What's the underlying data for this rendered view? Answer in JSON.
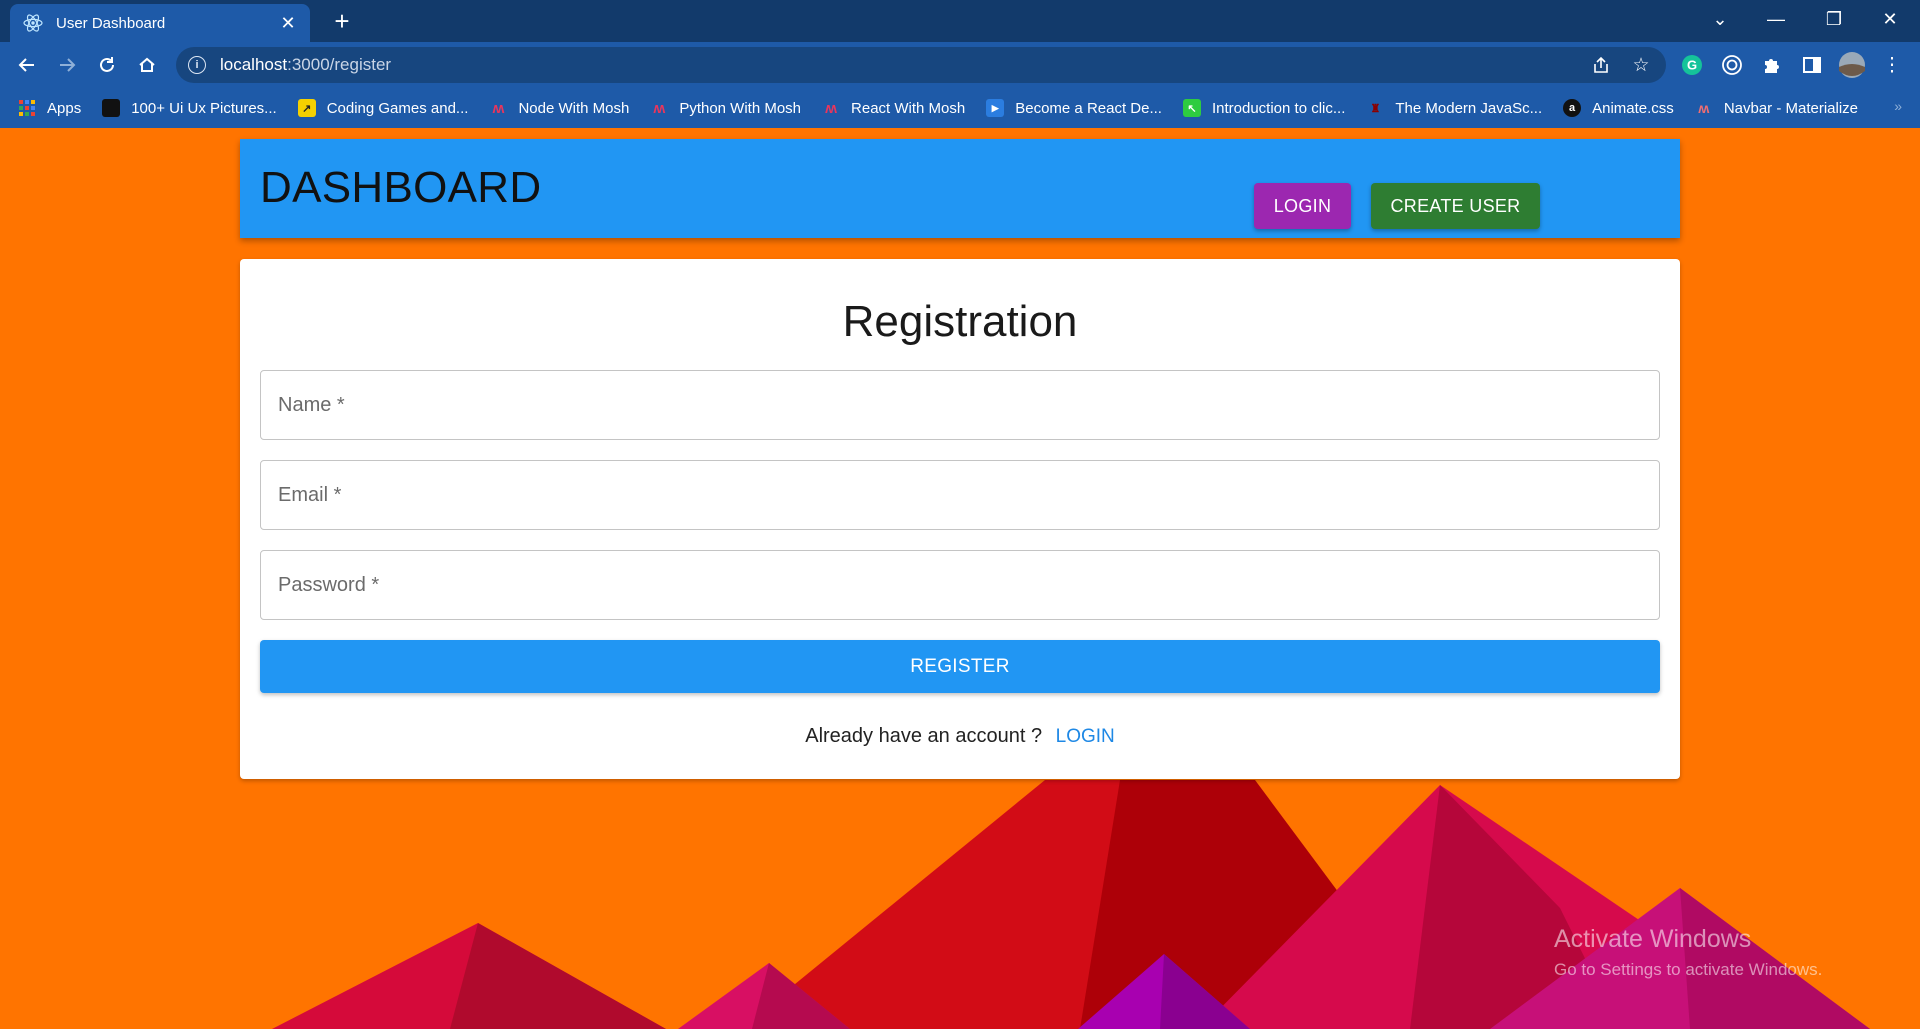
{
  "browser": {
    "tab_title": "User Dashboard",
    "tab_close": "✕",
    "new_tab": "+",
    "url_host": "localhost",
    "url_path": ":3000/register",
    "window_controls": {
      "minimize": "—",
      "restore": "❐",
      "close": "✕",
      "tab_search": "⌄"
    },
    "bookmarks": [
      {
        "label": "Apps",
        "icon": "apps-grid-icon"
      },
      {
        "label": "100+ Ui Ux Pictures...",
        "icon": "bookmark-icon"
      },
      {
        "label": "Coding Games and...",
        "icon": "bookmark-icon"
      },
      {
        "label": "Node With Mosh",
        "icon": "mosh-icon"
      },
      {
        "label": "Python With Mosh",
        "icon": "mosh-icon"
      },
      {
        "label": "React With Mosh",
        "icon": "mosh-icon"
      },
      {
        "label": "Become a React De...",
        "icon": "play-icon"
      },
      {
        "label": "Introduction to clic...",
        "icon": "bookmark-icon"
      },
      {
        "label": "The Modern JavaSc...",
        "icon": "bookmark-icon"
      },
      {
        "label": "Animate.css",
        "icon": "bookmark-icon"
      },
      {
        "label": "Navbar - Materialize",
        "icon": "materialize-icon"
      }
    ],
    "bookmarks_more": "»"
  },
  "header": {
    "brand": "DASHBOARD",
    "login_label": "LOGIN",
    "create_user_label": "CREATE USER"
  },
  "registration": {
    "title": "Registration",
    "name_placeholder": "Name *",
    "email_placeholder": "Email *",
    "password_placeholder": "Password *",
    "register_label": "REGISTER",
    "have_account_text": "Already have an account ?",
    "login_link": "LOGIN"
  },
  "watermark": {
    "line1": "Activate Windows",
    "line2": "Go to Settings to activate Windows."
  },
  "colors": {
    "background": "#ff7400",
    "appbar": "#2196f3",
    "login_button": "#9c27b0",
    "create_user_button": "#2e7d32",
    "register_button": "#2196f3"
  }
}
